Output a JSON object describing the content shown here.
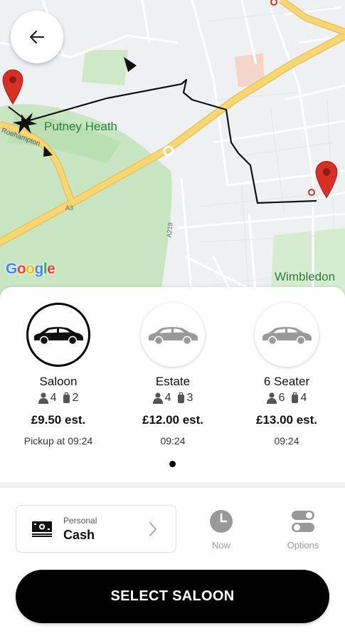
{
  "map": {
    "place_label_1": "Putney Heath",
    "place_label_2": "Wimbledon",
    "road_label_1": "Roehampton",
    "road_label_2": "A219",
    "road_label_3": "A3",
    "attribution": "Google",
    "pin_color": "#d93025"
  },
  "vehicles": [
    {
      "name": "Saloon",
      "passengers": "4",
      "luggage": "2",
      "price": "£9.50 est.",
      "pickup": "Pickup at 09:24",
      "selected": true
    },
    {
      "name": "Estate",
      "passengers": "4",
      "luggage": "3",
      "price": "£12.00 est.",
      "pickup": "09:24",
      "selected": false
    },
    {
      "name": "6 Seater",
      "passengers": "6",
      "luggage": "4",
      "price": "£13.00 est.",
      "pickup": "09:24",
      "selected": false
    }
  ],
  "payment": {
    "type_label": "Personal",
    "method": "Cash"
  },
  "options": {
    "now_label": "Now",
    "options_label": "Options"
  },
  "select_button": "SELECT SALOON",
  "colors": {
    "accent": "#000000",
    "map_park": "#c8e6c1",
    "map_road": "#f7d774"
  }
}
